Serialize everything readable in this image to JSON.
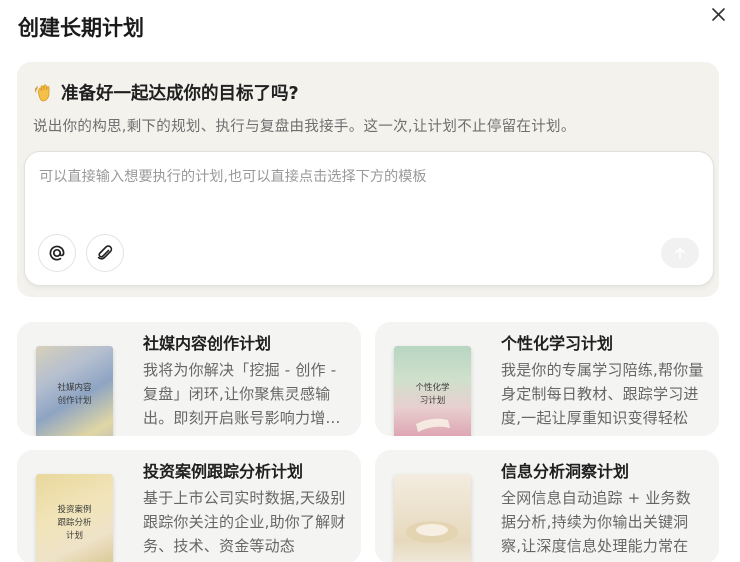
{
  "dialog": {
    "title": "创建长期计划"
  },
  "hero": {
    "emoji": "👋",
    "heading": "准备好一起达成你的目标了吗?",
    "subtitle": "说出你的构思,剩下的规划、执行与复盘由我接手。这一次,让计划不止停留在计划。"
  },
  "input": {
    "placeholder": "可以直接输入想要执行的计划,也可以直接点击选择下方的模板",
    "value": ""
  },
  "templates": [
    {
      "title": "社媒内容创作计划",
      "cover_line1": "社媒内容",
      "cover_line2": "创作计划",
      "desc": "我将为你解决「挖掘 - 创作 - 复盘」闭环,让你聚焦灵感输出。即刻开启账号影响力增长之旅"
    },
    {
      "title": "个性化学习计划",
      "cover_line1": "个性化学",
      "cover_line2": "习计划",
      "desc": "我是你的专属学习陪练,帮你量身定制每日教材、跟踪学习进度,一起让厚重知识变得轻松"
    },
    {
      "title": "投资案例跟踪分析计划",
      "cover_line1": "投资案例",
      "cover_line2": "跟踪分析",
      "cover_line3": "计划",
      "desc": "基于上市公司实时数据,天级别跟踪你关注的企业,助你了解财务、技术、资金等动态"
    },
    {
      "title": "信息分析洞察计划",
      "desc": "全网信息自动追踪 + 业务数据分析,持续为你输出关键洞察,让深度信息处理能力常在"
    }
  ],
  "colors": {
    "hero_bg": "#f3f2ed",
    "card_bg": "#f4f4f2",
    "title": "#1a1a1a",
    "muted": "#6f6f6f"
  },
  "icons": [
    "close-icon",
    "wave-hand-icon",
    "at-icon",
    "paperclip-icon",
    "arrow-up-icon"
  ]
}
